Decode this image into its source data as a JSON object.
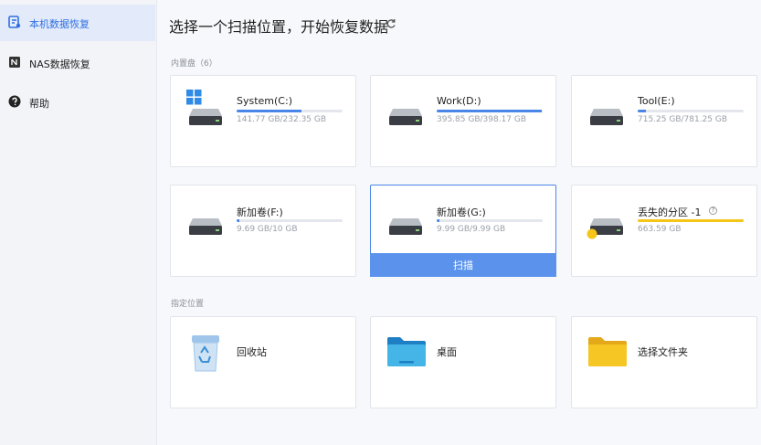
{
  "sidebar": {
    "items": [
      {
        "label": "本机数据恢复",
        "icon": "local-recovery-icon",
        "active": true
      },
      {
        "label": "NAS数据恢复",
        "icon": "nas-icon",
        "active": false
      },
      {
        "label": "帮助",
        "icon": "help-icon",
        "active": false
      }
    ]
  },
  "main": {
    "title": "选择一个扫描位置，开始恢复数据",
    "internal_section": "内置盘（6）",
    "specified_section": "指定位置",
    "scan_label": "扫描",
    "drives": [
      {
        "name": "System(C:)",
        "size": "141.77 GB/232.35 GB",
        "used_fraction": 0.61,
        "windows": true
      },
      {
        "name": "Work(D:)",
        "size": "395.85 GB/398.17 GB",
        "used_fraction": 0.99
      },
      {
        "name": "Tool(E:)",
        "size": "715.25 GB/781.25 GB",
        "used_fraction": 0.08
      },
      {
        "name": "新加卷(F:)",
        "size": "9.69 GB/10 GB",
        "used_fraction": 0.03
      },
      {
        "name": "新加卷(G:)",
        "size": "9.99 GB/9.99 GB",
        "used_fraction": 0.03,
        "selected": true
      },
      {
        "name": "丢失的分区 -1",
        "size": "663.59 GB",
        "used_fraction": 1.0,
        "lost": true,
        "help_glyph": "?"
      }
    ],
    "locations": [
      {
        "label": "回收站",
        "icon": "recycle-bin-icon"
      },
      {
        "label": "桌面",
        "icon": "desktop-folder-icon"
      },
      {
        "label": "选择文件夹",
        "icon": "folder-icon"
      }
    ]
  },
  "colors": {
    "accent": "#4a86e8",
    "scan_button": "#5b93ec",
    "lost_partition": "#f5c518",
    "sidebar_active_bg": "#e3ebfa"
  }
}
